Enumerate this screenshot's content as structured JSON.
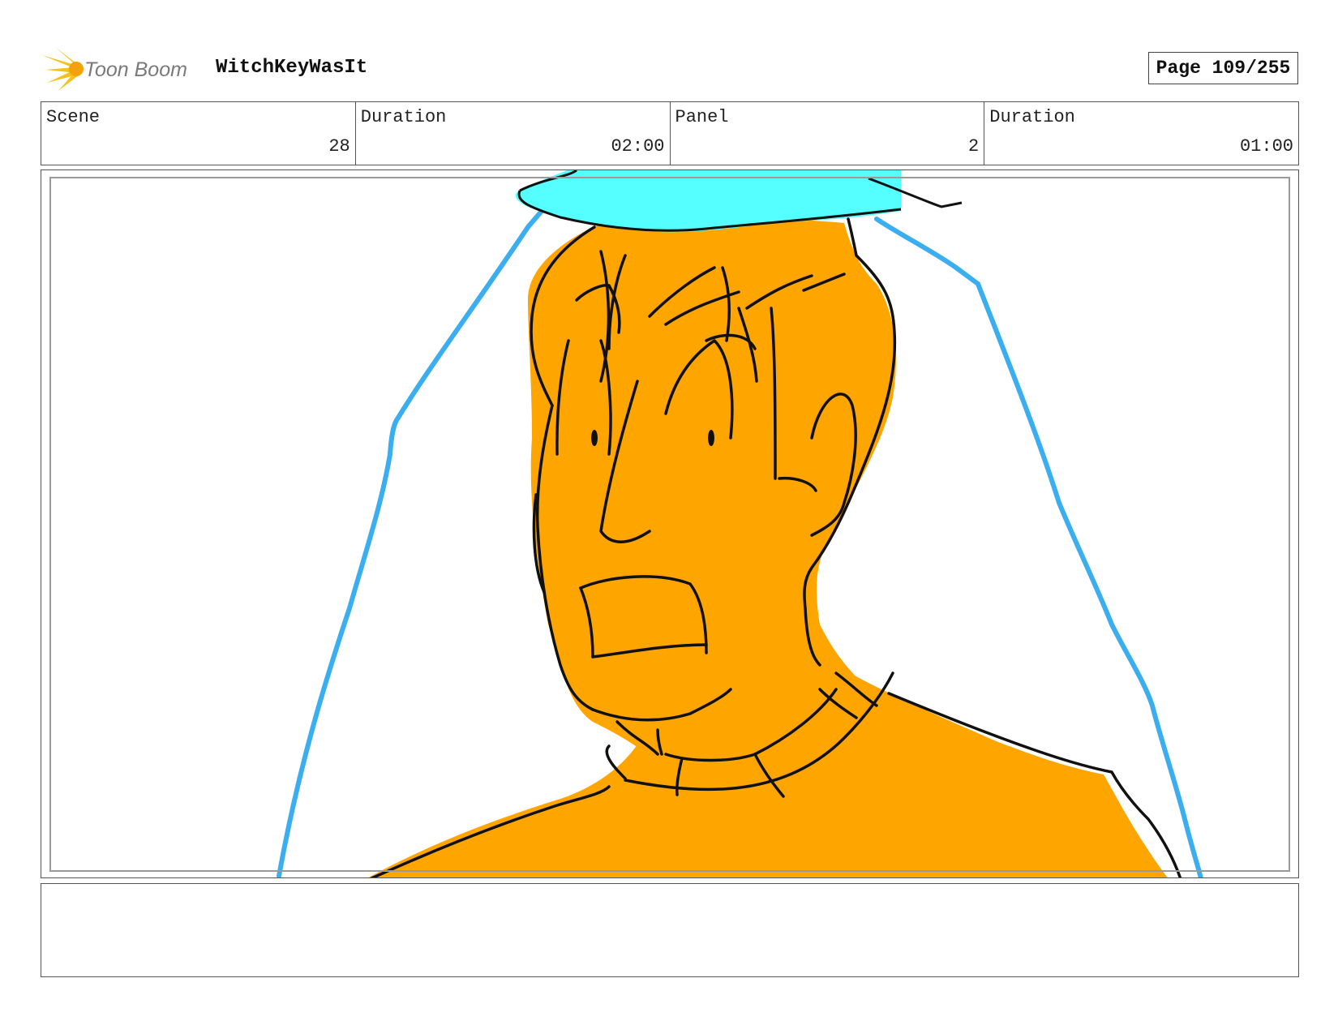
{
  "header": {
    "logo_text": "Toon Boom",
    "project_title": "WitchKeyWasIt",
    "page_label": "Page 109/255"
  },
  "info": {
    "scene_label": "Scene",
    "scene_value": "28",
    "scene_duration_label": "Duration",
    "scene_duration_value": "02:00",
    "panel_label": "Panel",
    "panel_value": "2",
    "panel_duration_label": "Duration",
    "panel_duration_value": "01:00"
  },
  "colors": {
    "skin": "#FFA500",
    "hat": "#55FFFF",
    "veil": "#3AAEEF",
    "ink": "#111111",
    "logo_yellow": "#F6C21A"
  },
  "icons": {
    "logo": "toon-boom-burst-icon"
  },
  "notes": {
    "text": ""
  }
}
